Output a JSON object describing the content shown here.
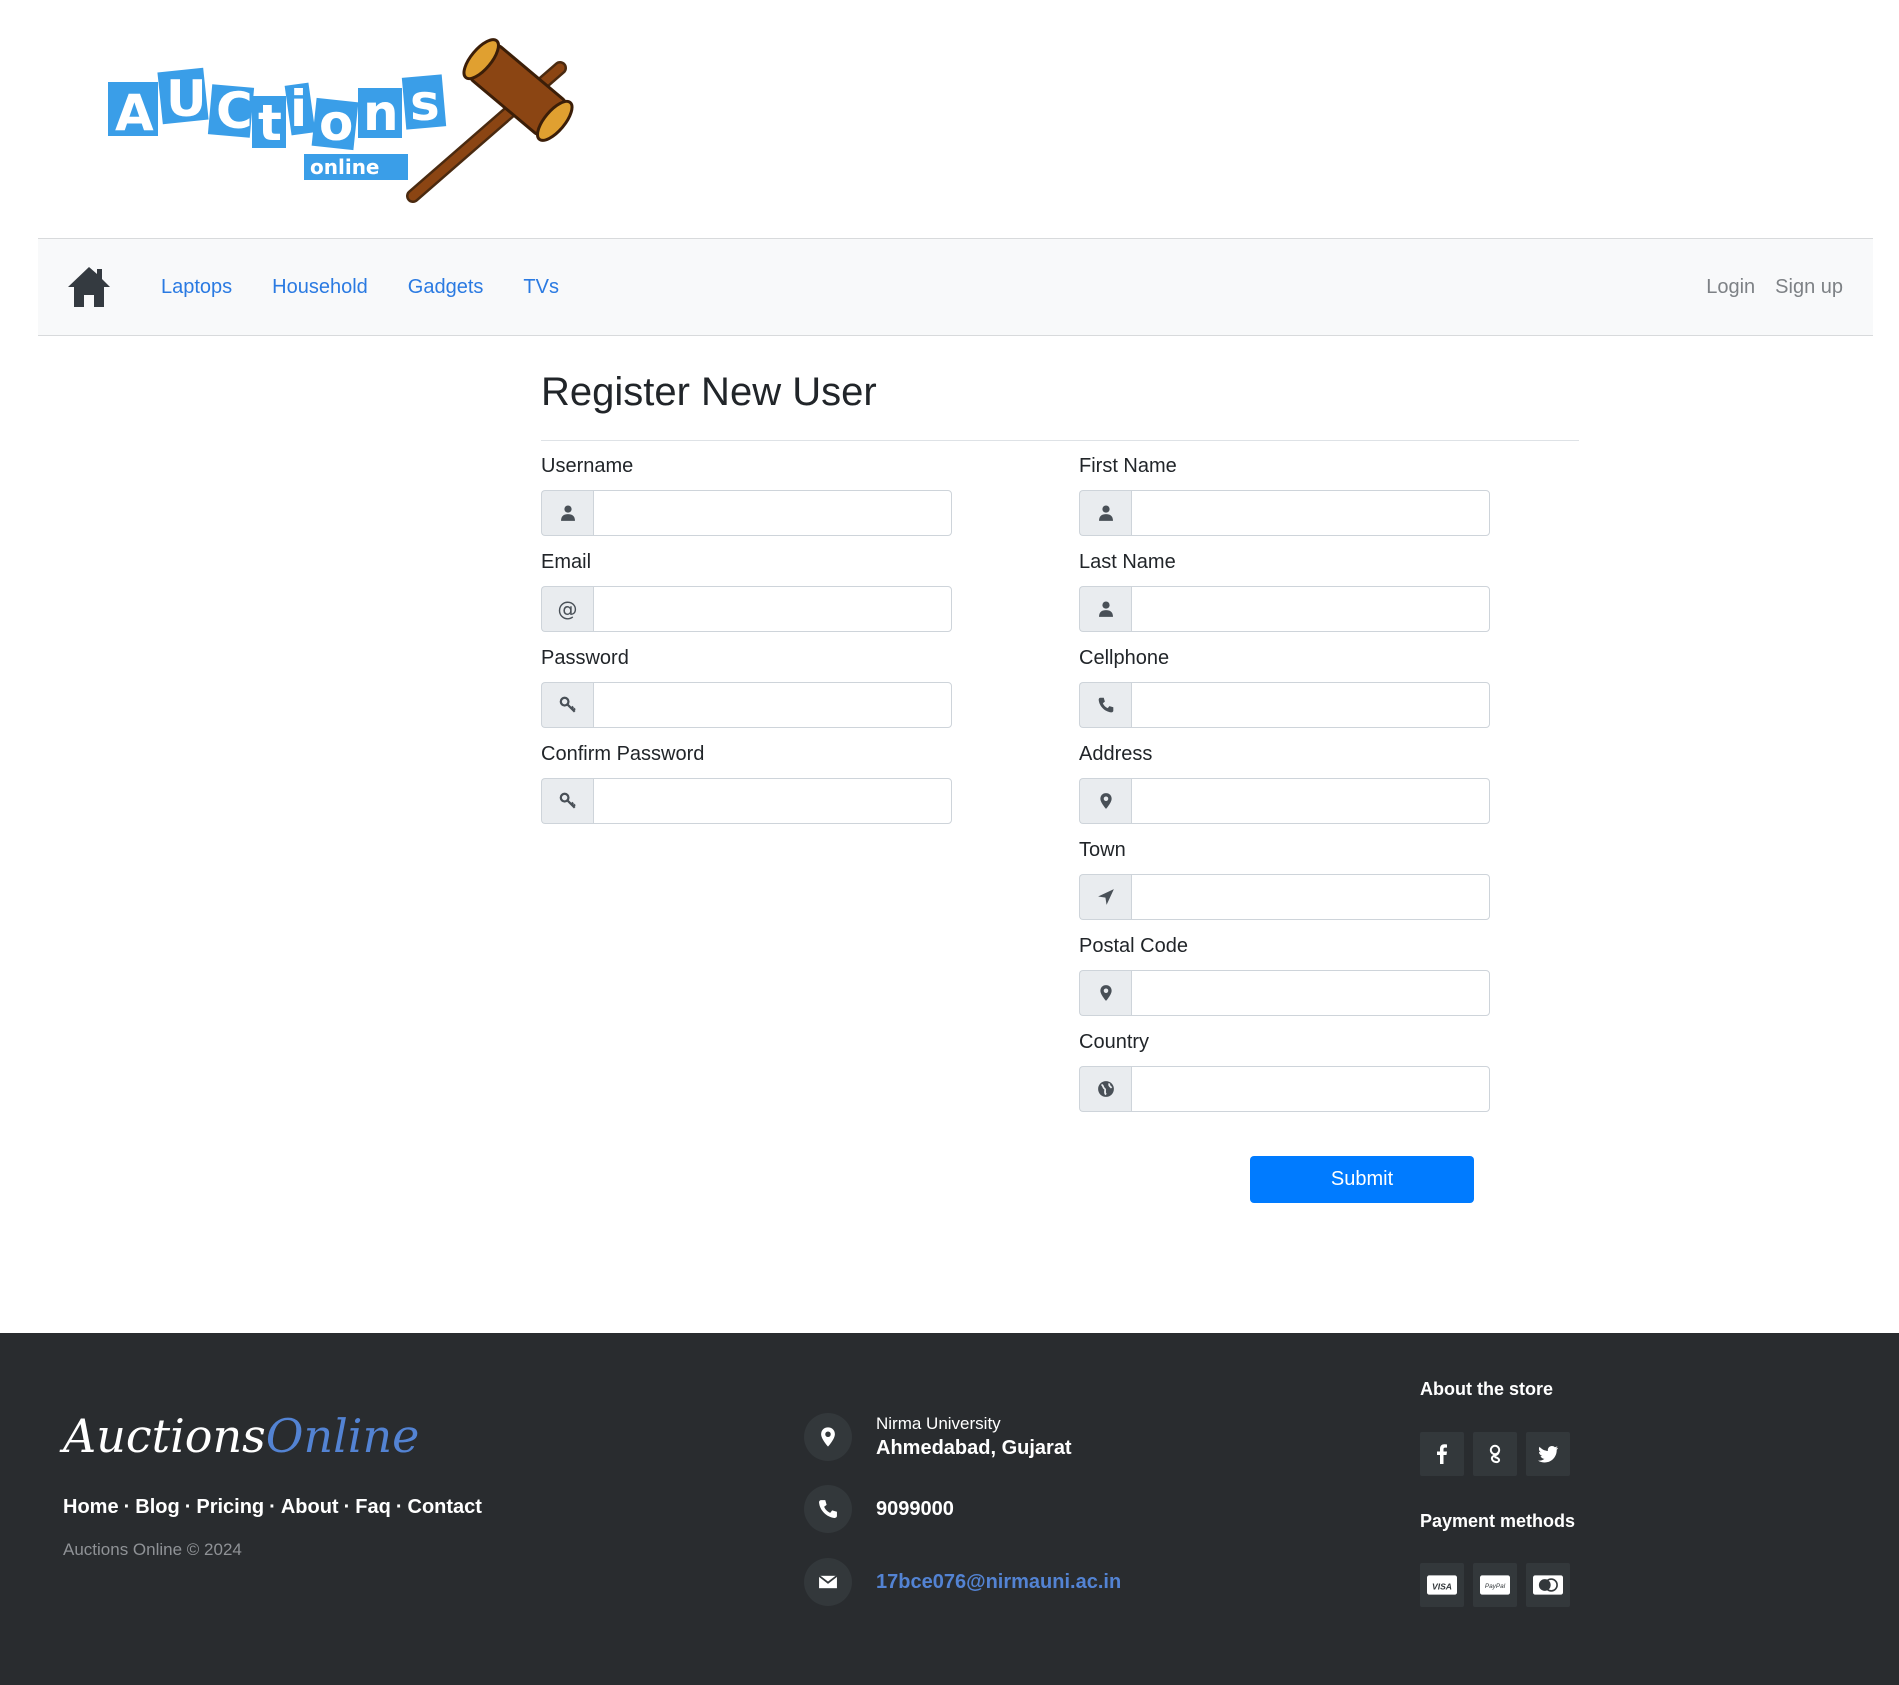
{
  "logo": {
    "title": "Auctions",
    "subtitle": "online"
  },
  "navbar": {
    "home_icon": "home-icon",
    "links": [
      "Laptops",
      "Household",
      "Gadgets",
      "TVs"
    ],
    "login": "Login",
    "signup": "Sign up"
  },
  "form": {
    "title": "Register New User",
    "left": [
      {
        "label": "Username",
        "icon": "user-icon",
        "value": ""
      },
      {
        "label": "Email",
        "icon": "at-sign-icon",
        "value": ""
      },
      {
        "label": "Password",
        "icon": "key-icon",
        "value": ""
      },
      {
        "label": "Confirm Password",
        "icon": "key-icon",
        "value": ""
      }
    ],
    "right": [
      {
        "label": "First Name",
        "icon": "user-icon",
        "value": ""
      },
      {
        "label": "Last Name",
        "icon": "user-icon",
        "value": ""
      },
      {
        "label": "Cellphone",
        "icon": "phone-icon",
        "value": ""
      },
      {
        "label": "Address",
        "icon": "map-marker-icon",
        "value": ""
      },
      {
        "label": "Town",
        "icon": "location-arrow-icon",
        "value": ""
      },
      {
        "label": "Postal Code",
        "icon": "map-marker-icon",
        "value": ""
      },
      {
        "label": "Country",
        "icon": "globe-icon",
        "value": ""
      }
    ],
    "submit": "Submit",
    "at_symbol": "@"
  },
  "footer": {
    "brand_part1": "Auctions",
    "brand_part2": "Online",
    "links": [
      "Home",
      "Blog",
      "Pricing",
      "About",
      "Faq",
      "Contact"
    ],
    "separator": "·",
    "copyright": "Auctions Online © 2024",
    "address_line1": "Nirma University",
    "address_line2": "Ahmedabad, Gujarat",
    "phone": "9099000",
    "email": "17bce076@nirmauni.ac.in",
    "about_title": "About the store",
    "social_icons": [
      "facebook-icon",
      "google-plus-icon",
      "twitter-icon"
    ],
    "payment_title": "Payment methods",
    "payment_icons": [
      "visa-icon",
      "paypal-icon",
      "mastercard-icon"
    ],
    "payment_visa_text": "VISA",
    "payment_paypal_text": "PayPal"
  },
  "colors": {
    "link": "#2a7ae2",
    "button": "#007bff",
    "footer_bg": "#292c2f",
    "footer_accent": "#5383d3",
    "logo_blue": "#3a9ee8",
    "gavel_brown": "#8b4513"
  }
}
